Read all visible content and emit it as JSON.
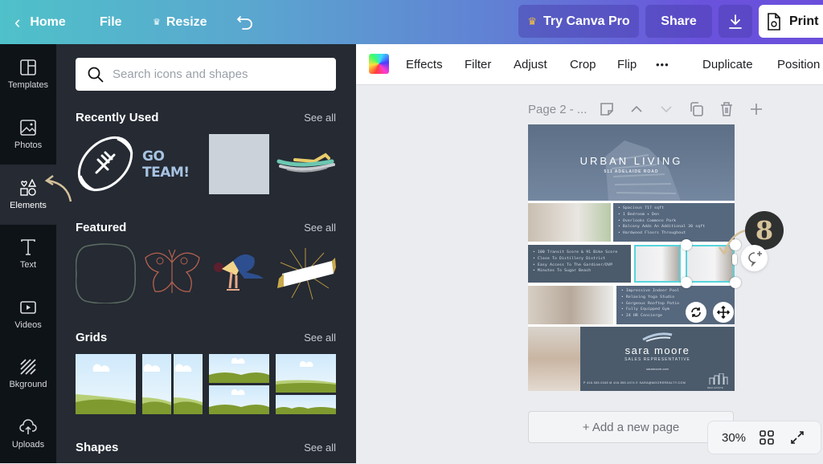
{
  "topbar": {
    "home_label": "Home",
    "file_label": "File",
    "resize_label": "Resize",
    "try_pro_label": "Try Canva Pro",
    "share_label": "Share",
    "print_label": "Print"
  },
  "rail": {
    "items": [
      {
        "label": "Templates",
        "icon": "templates-icon"
      },
      {
        "label": "Photos",
        "icon": "photos-icon"
      },
      {
        "label": "Elements",
        "icon": "elements-icon",
        "active": true
      },
      {
        "label": "Text",
        "icon": "text-icon"
      },
      {
        "label": "Videos",
        "icon": "videos-icon"
      },
      {
        "label": "Bkground",
        "icon": "background-icon"
      },
      {
        "label": "Uploads",
        "icon": "uploads-icon"
      }
    ]
  },
  "panel": {
    "search_placeholder": "Search icons and shapes",
    "sections": [
      {
        "title": "Recently Used",
        "see_all": "See all",
        "items": [
          "football",
          "GO TEAM!",
          "gray square",
          "brush strokes"
        ]
      },
      {
        "title": "Featured",
        "see_all": "See all",
        "items": [
          "rounded frame",
          "butterfly",
          "yoga pose",
          "ribbon banner"
        ]
      },
      {
        "title": "Grids",
        "see_all": "See all",
        "items": [
          "single grid",
          "two column grid",
          "two row grid",
          "mixed grid"
        ]
      },
      {
        "title": "Shapes",
        "see_all": "See all"
      }
    ],
    "go_team_text": "GO TEAM!"
  },
  "context_toolbar": {
    "items": [
      "Effects",
      "Filter",
      "Adjust",
      "Crop",
      "Flip",
      "•••",
      "Duplicate",
      "Position"
    ]
  },
  "canvas": {
    "page_title": "Page 2 - ...",
    "add_page_label": "+ Add a new page",
    "zoom_level": "30%",
    "step_badge": "8"
  },
  "design": {
    "headline": "URBAN LIVING",
    "address": "511 ADELAIDE ROAD",
    "features_1": [
      "Spacious 717 sqft",
      "1 Bedroom + Den",
      "Overlooks Commons Park",
      "Balcony Adds An Additional 30 sqft",
      "Hardwood Floors Throughout"
    ],
    "features_2": [
      "100 Transit Score & 91 Bike Score",
      "Close To Distillery District",
      "Easy Access To The Gardiner/DVP",
      "Minutes To Sugar Beach"
    ],
    "features_3": [
      "Impressive Indoor Pool",
      "Relaxing Yoga Studio",
      "Gorgeous Rooftop Patio",
      "Fully Equipped Gym",
      "24 HR Concierge"
    ],
    "agent_name": "sara moore",
    "agent_title": "SALES REPRESENTATIVE",
    "agent_site": "saramoore.com",
    "contact_line": "P 416.555.0345  M 416.555.4074  E SARA@MOOREREALTY.COM",
    "brand": "REAL ESTATE"
  }
}
